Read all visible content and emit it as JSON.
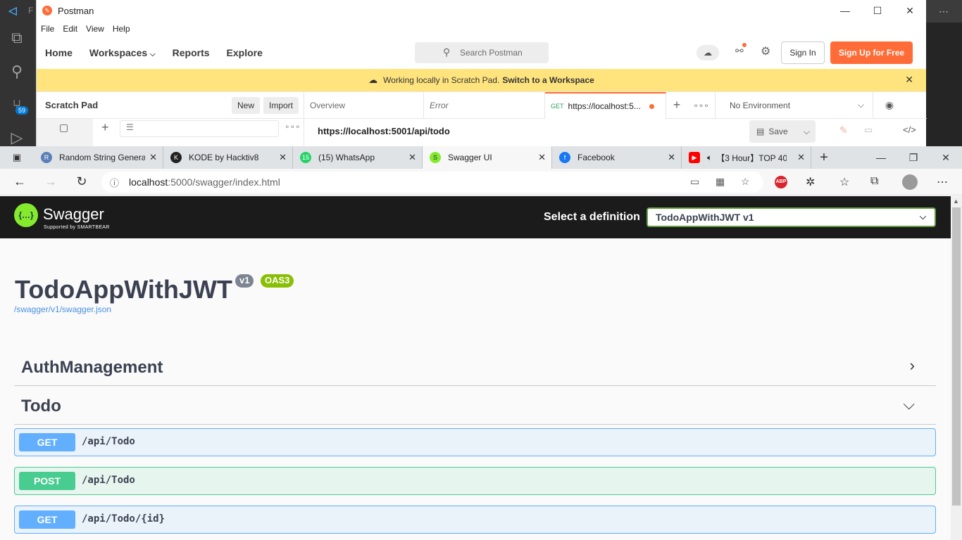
{
  "vscode": {
    "logo": "⟨⟩",
    "letter": "F",
    "badge": "59"
  },
  "postman": {
    "title": "Postman",
    "menu": [
      "File",
      "Edit",
      "View",
      "Help"
    ],
    "nav": {
      "home": "Home",
      "workspaces": "Workspaces",
      "reports": "Reports",
      "explore": "Explore"
    },
    "search_placeholder": "Search Postman",
    "sign_in": "Sign In",
    "sign_up": "Sign Up for Free",
    "banner": {
      "text": "Working locally in Scratch Pad.",
      "link": "Switch to a Workspace"
    },
    "sidebar": {
      "title": "Scratch Pad",
      "new_btn": "New",
      "import_btn": "Import"
    },
    "tabs": {
      "overview": "Overview",
      "error": "Error",
      "active_method": "GET",
      "active_label": "https://localhost:5..."
    },
    "environment": "No Environment",
    "request_url": "https://localhost:5001/api/todo",
    "save": "Save"
  },
  "edge": {
    "tabs": [
      {
        "label": "Random String Generator",
        "color": "#5b7fb8",
        "icon": "R"
      },
      {
        "label": "KODE by Hacktiv8",
        "color": "#222222",
        "icon": "K"
      },
      {
        "label": "(15) WhatsApp",
        "color": "#25d366",
        "icon": "15"
      },
      {
        "label": "Swagger UI",
        "color": "#85ea2d",
        "icon": "S"
      },
      {
        "label": "Facebook",
        "color": "#1877f2",
        "icon": "f"
      },
      {
        "label": "【3 Hour】TOP 40 ...",
        "color": "#ff0000",
        "icon": "▶"
      }
    ],
    "url_host": "localhost",
    "url_path": ":5000/swagger/index.html"
  },
  "swagger": {
    "logo_text": "Swagger",
    "logo_sub": "Supported by SMARTBEAR",
    "select_label": "Select a definition",
    "selected_definition": "TodoAppWithJWT v1",
    "title": "TodoAppWithJWT",
    "version": "v1",
    "oas": "OAS3",
    "json_link": "/swagger/v1/swagger.json",
    "tags": [
      {
        "name": "AuthManagement",
        "expanded": false
      },
      {
        "name": "Todo",
        "expanded": true
      }
    ],
    "operations": [
      {
        "method": "GET",
        "path": "/api/Todo"
      },
      {
        "method": "POST",
        "path": "/api/Todo"
      },
      {
        "method": "GET",
        "path": "/api/Todo/{id}"
      }
    ]
  }
}
